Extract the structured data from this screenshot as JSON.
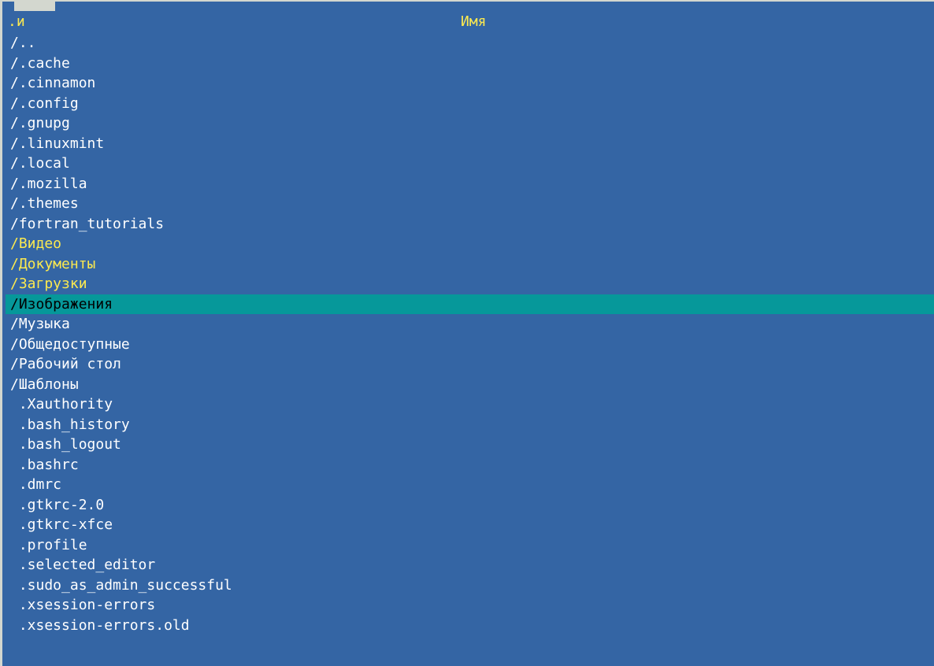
{
  "colors": {
    "panel_bg": "#3465a4",
    "header_text": "#fce94f",
    "dir_special": "#fce94f",
    "selection_bg": "#06989a",
    "normal_text": "#ffffff"
  },
  "header": {
    "sort_indicator": ".и",
    "column_name": "Имя"
  },
  "entries": [
    {
      "text": "/..",
      "style": "normal"
    },
    {
      "text": "/.cache",
      "style": "normal"
    },
    {
      "text": "/.cinnamon",
      "style": "normal"
    },
    {
      "text": "/.config",
      "style": "normal"
    },
    {
      "text": "/.gnupg",
      "style": "normal"
    },
    {
      "text": "/.linuxmint",
      "style": "normal"
    },
    {
      "text": "/.local",
      "style": "normal"
    },
    {
      "text": "/.mozilla",
      "style": "normal"
    },
    {
      "text": "/.themes",
      "style": "normal"
    },
    {
      "text": "/fortran_tutorials",
      "style": "normal"
    },
    {
      "text": "/Видео",
      "style": "yellow"
    },
    {
      "text": "/Документы",
      "style": "yellow"
    },
    {
      "text": "/Загрузки",
      "style": "yellow"
    },
    {
      "text": "/Изображения",
      "style": "selected"
    },
    {
      "text": "/Музыка",
      "style": "normal"
    },
    {
      "text": "/Общедоступные",
      "style": "normal"
    },
    {
      "text": "/Рабочий стол",
      "style": "normal"
    },
    {
      "text": "/Шаблоны",
      "style": "normal"
    },
    {
      "text": " .Xauthority",
      "style": "normal"
    },
    {
      "text": " .bash_history",
      "style": "normal"
    },
    {
      "text": " .bash_logout",
      "style": "normal"
    },
    {
      "text": " .bashrc",
      "style": "normal"
    },
    {
      "text": " .dmrc",
      "style": "normal"
    },
    {
      "text": " .gtkrc-2.0",
      "style": "normal"
    },
    {
      "text": " .gtkrc-xfce",
      "style": "normal"
    },
    {
      "text": " .profile",
      "style": "normal"
    },
    {
      "text": " .selected_editor",
      "style": "normal"
    },
    {
      "text": " .sudo_as_admin_successful",
      "style": "normal"
    },
    {
      "text": " .xsession-errors",
      "style": "normal"
    },
    {
      "text": " .xsession-errors.old",
      "style": "normal"
    }
  ]
}
